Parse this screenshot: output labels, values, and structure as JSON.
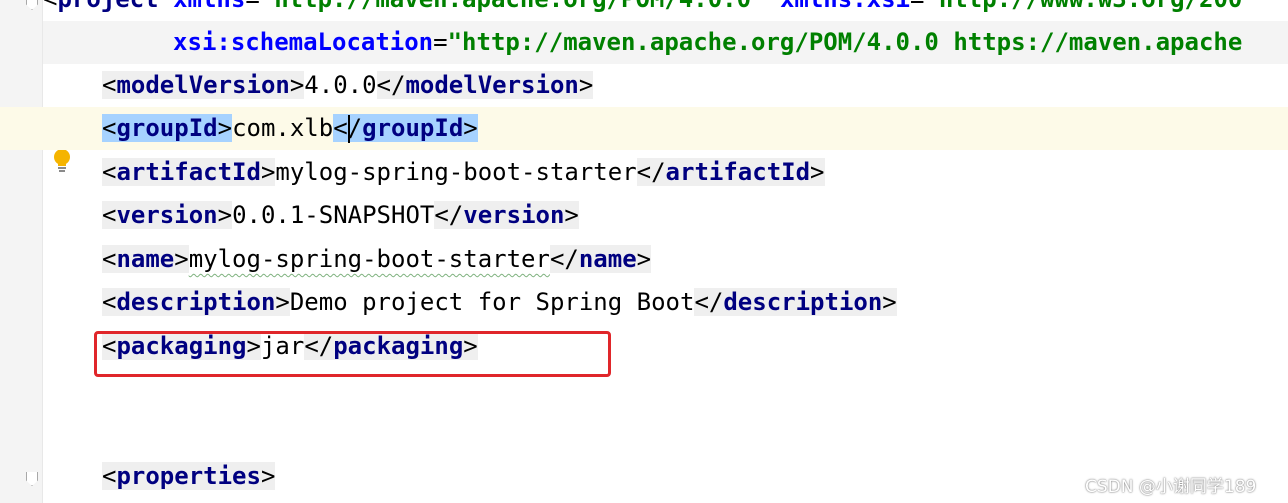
{
  "editor": {
    "lines": {
      "project_open": {
        "bracket_open": "<",
        "tag": "project",
        "attr1": "xmlns",
        "eq1": "=",
        "val1": "\"http://maven.apache.org/POM/4.0.0\"",
        "attr2": "xmlns:xsi",
        "eq2": "=",
        "val2": "\"http://www.w3.org/200"
      },
      "schema": {
        "attr": "xsi:schemaLocation",
        "eq": "=",
        "val": "\"http://maven.apache.org/POM/4.0.0 https://maven.apache"
      },
      "modelVersion": {
        "open": "modelVersion",
        "text": "4.0.0",
        "close": "modelVersion"
      },
      "groupId": {
        "open": "groupId",
        "text": "com.xlb",
        "close": "groupId"
      },
      "artifactId": {
        "open": "artifactId",
        "text": "mylog-spring-boot-starter",
        "close": "artifactId"
      },
      "version": {
        "open": "version",
        "text": "0.0.1-SNAPSHOT",
        "close": "version"
      },
      "name": {
        "open": "name",
        "text": "mylog-spring-boot-starter",
        "close": "name"
      },
      "description": {
        "open": "description",
        "text": "Demo project for Spring Boot",
        "close": "description"
      },
      "packaging": {
        "open": "packaging",
        "text": "jar",
        "close": "packaging"
      },
      "properties": {
        "open": "properties"
      }
    },
    "highlight_color": "#e0262a",
    "current_line_color": "#fdfae8",
    "tag_color": "#000080",
    "string_color": "#008000"
  },
  "watermark": {
    "text": "CSDN @小谢同学189"
  }
}
